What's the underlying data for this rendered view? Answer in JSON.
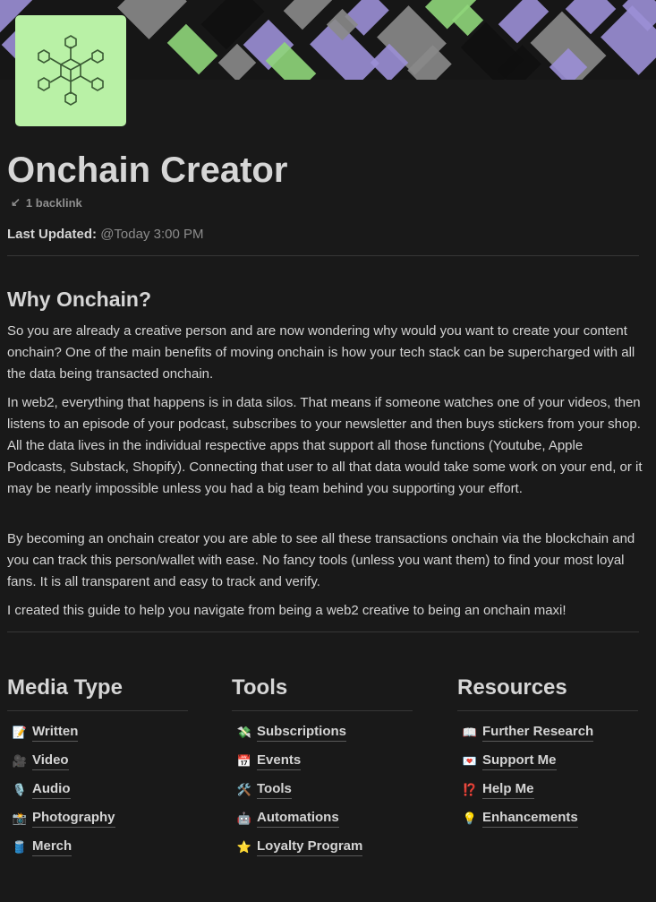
{
  "colors": {
    "background": "#191919",
    "icon_background": "#b9f1a6",
    "cover_purple": "#9b8fd6",
    "cover_green": "#8fd67a",
    "cover_gray": "#8a8a8a"
  },
  "page": {
    "icon": "molecule-hexagon-icon",
    "title": "Onchain Creator",
    "backlink_text": "1 backlink",
    "last_updated_label": "Last Updated:",
    "last_updated_value": "@Today 3:00 PM"
  },
  "section": {
    "heading": "Why Onchain?",
    "paragraphs": [
      "So you are already a creative person and are now wondering why would you want to create your content onchain? One of the main benefits of moving onchain is how your tech stack can be supercharged with all the data being transacted onchain.",
      "In web2, everything that happens is in data silos. That means if someone watches one of your videos, then listens to an episode of your podcast, subscribes to your newsletter and then buys stickers from your shop. All the data lives in the individual respective apps that support all those functions (Youtube, Apple Podcasts, Substack, Shopify). Connecting that user to all that data would take some work on your end, or it may be nearly impossible unless you had a big team behind you supporting your effort.",
      "By becoming an onchain creator you are able to see all these transactions onchain via the blockchain and you can track this person/wallet with ease. No fancy tools (unless you want them) to find your most loyal fans. It is all transparent and easy to track and verify.",
      "I created this guide to help you navigate from being a web2 creative to being an onchain maxi!"
    ]
  },
  "columns": [
    {
      "title": "Media Type",
      "items": [
        {
          "emoji": "📝",
          "label": "Written"
        },
        {
          "emoji": "🎥",
          "label": "Video"
        },
        {
          "emoji": "🎙️",
          "label": "Audio"
        },
        {
          "emoji": "📸",
          "label": "Photography"
        },
        {
          "emoji": "🛢️",
          "label": "Merch"
        }
      ]
    },
    {
      "title": "Tools",
      "items": [
        {
          "emoji": "💸",
          "label": "Subscriptions"
        },
        {
          "emoji": "📅",
          "label": "Events"
        },
        {
          "emoji": "🛠️",
          "label": "Tools"
        },
        {
          "emoji": "🤖",
          "label": "Automations"
        },
        {
          "emoji": "⭐",
          "label": "Loyalty Program"
        }
      ]
    },
    {
      "title": "Resources",
      "items": [
        {
          "emoji": "📖",
          "label": "Further Research"
        },
        {
          "emoji": "💌",
          "label": "Support Me"
        },
        {
          "emoji": "⁉️",
          "label": "Help Me"
        },
        {
          "emoji": "💡",
          "label": "Enhancements"
        }
      ]
    }
  ]
}
